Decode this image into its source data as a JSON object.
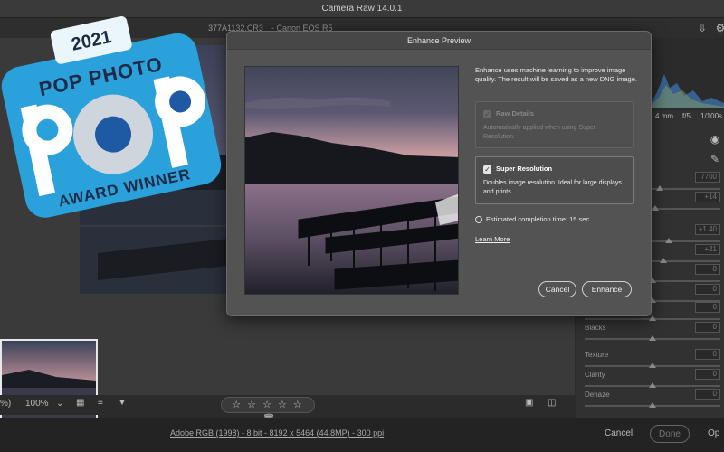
{
  "window": {
    "title": "Camera Raw 14.0.1"
  },
  "file": {
    "name": "377A1132.CR3",
    "separator": "-",
    "camera": "Canon EOS R5"
  },
  "exif": {
    "focal": "4 mm",
    "aperture": "f/5",
    "shutter": "1/100s"
  },
  "panel": {
    "sliders": [
      {
        "label": "",
        "value": "7700",
        "thumb_pos": 0.55
      },
      {
        "label": "",
        "value": "+14",
        "thumb_pos": 0.52
      },
      {
        "label": "",
        "value": "+1.40",
        "thumb_pos": 0.62
      },
      {
        "label": "",
        "value": "+21",
        "thumb_pos": 0.58
      },
      {
        "label": "",
        "value": "0",
        "thumb_pos": 0.5
      },
      {
        "label": "",
        "value": "0",
        "thumb_pos": 0.5
      },
      {
        "label": "",
        "value": "0",
        "thumb_pos": 0.5
      },
      {
        "label": "Blacks",
        "value": "0",
        "thumb_pos": 0.5
      },
      {
        "label": "Texture",
        "value": "0",
        "thumb_pos": 0.5
      },
      {
        "label": "Clarity",
        "value": "0",
        "thumb_pos": 0.5
      },
      {
        "label": "Dehaze",
        "value": "0",
        "thumb_pos": 0.5
      }
    ]
  },
  "toolbar": {
    "zoom_left": "%)",
    "zoom": "100%",
    "stars": "☆ ☆ ☆ ☆ ☆"
  },
  "footer": {
    "image_info": "Adobe RGB (1998) - 8 bit - 8192 x 5464 (44.8MP) - 300 ppi",
    "cancel": "Cancel",
    "done": "Done",
    "open": "Op"
  },
  "dialog": {
    "title": "Enhance Preview",
    "description": "Enhance uses machine learning to improve image quality. The result will be saved as a new DNG image.",
    "raw_details": {
      "title": "Raw Details",
      "note": "Automatically applied when using Super Resolution.",
      "checked": true,
      "disabled": true
    },
    "super_resolution": {
      "title": "Super Resolution",
      "note": "Doubles image resolution. Ideal for large displays and prints.",
      "checked": true
    },
    "estimate": "Estimated completion time: 15 sec",
    "learn_more": "Learn More",
    "cancel": "Cancel",
    "enhance": "Enhance"
  },
  "badge": {
    "year": "2021",
    "top_text": "POP PHOTO",
    "big_text": "POP",
    "bottom_text": "AWARD WINNER",
    "color": "#2a9fd8"
  }
}
